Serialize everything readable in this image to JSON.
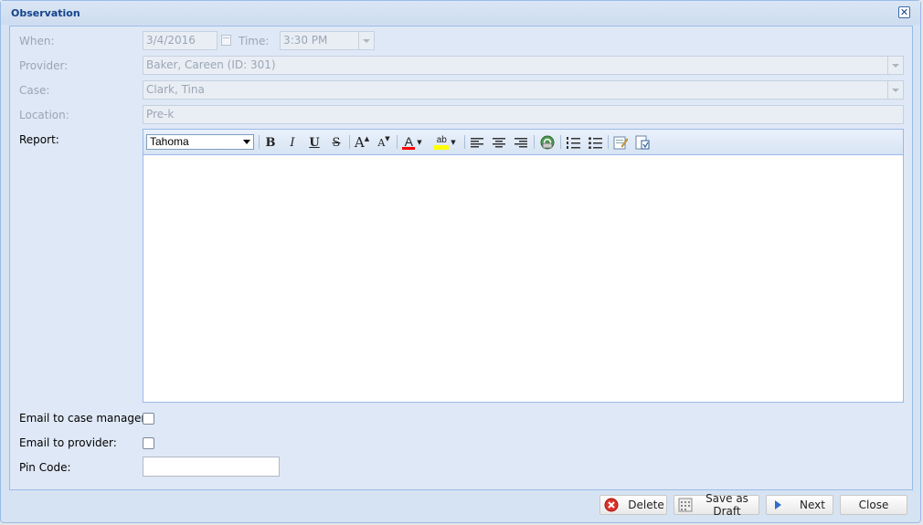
{
  "window": {
    "title": "Observation",
    "close_glyph": "✕"
  },
  "form": {
    "when_label": "When:",
    "when_date": "3/4/2016",
    "time_label": "Time:",
    "time_value": "3:30 PM",
    "provider_label": "Provider:",
    "provider_value": "Baker, Careen (ID: 301)",
    "case_label": "Case:",
    "case_value": "Clark, Tina",
    "location_label": "Location:",
    "location_value": "Pre-k",
    "report_label": "Report:",
    "email_case_manager_label": "Email to case manager:",
    "email_provider_label": "Email to provider:",
    "pin_label": "Pin Code:",
    "pin_value": "",
    "email_case_manager_checked": false,
    "email_provider_checked": false
  },
  "editor": {
    "font": "Tahoma",
    "content": "",
    "buttons": {
      "bold": "B",
      "italic": "I",
      "underline": "U",
      "strike": "S",
      "grow": "A",
      "shrink": "A",
      "font_color": "A",
      "highlight": "ab"
    },
    "icons": [
      "bold-icon",
      "italic-icon",
      "underline-icon",
      "strikethrough-icon",
      "increase-font-icon",
      "decrease-font-icon",
      "font-color-icon",
      "highlight-icon",
      "align-left-icon",
      "align-center-icon",
      "align-right-icon",
      "link-icon",
      "ordered-list-icon",
      "unordered-list-icon",
      "source-edit-icon",
      "paste-icon"
    ]
  },
  "footer": {
    "delete_label": "Delete",
    "save_draft_label": "Save as Draft",
    "next_label": "Next",
    "close_label": "Close"
  },
  "colors": {
    "title": "#15428b",
    "font_color_swatch": "#ff0000",
    "highlight_swatch": "#ffff00",
    "delete_icon": "#d9342b"
  }
}
